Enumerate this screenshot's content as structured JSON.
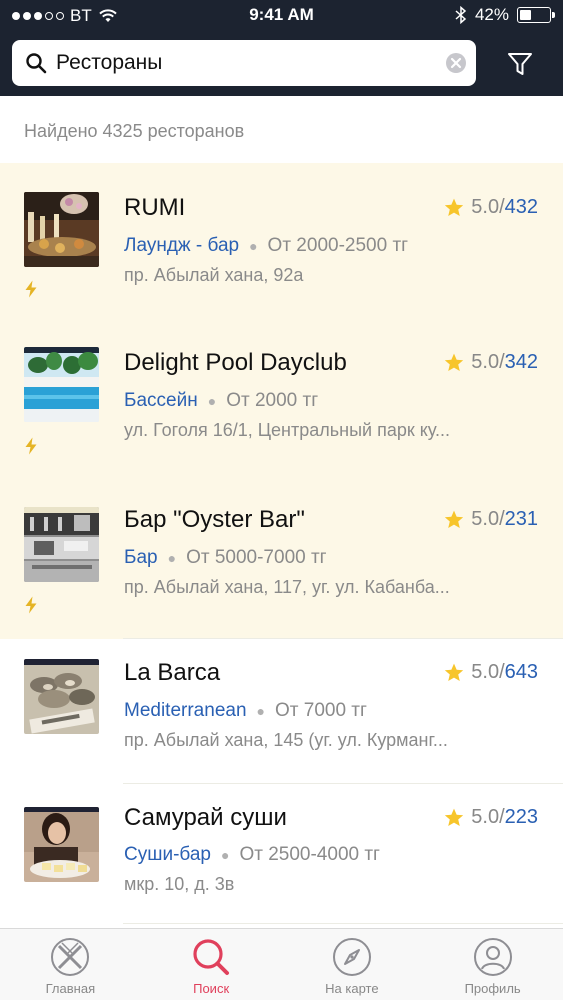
{
  "status_bar": {
    "carrier": "BT",
    "time": "9:41 AM",
    "battery_percent": "42%",
    "battery_level": 0.42,
    "signal_bars_filled": 3,
    "signal_bars_total": 5
  },
  "search": {
    "value": "Рестораны"
  },
  "results": {
    "found_text": "Найдено 4325 ресторанов"
  },
  "restaurants": [
    {
      "name": "RUMI",
      "score": "5.0/",
      "reviews": "432",
      "category": "Лаундж - бар",
      "price": "От 2000-2500 тг",
      "address": "пр. Абылай хана, 92а",
      "featured": true,
      "thumb": "rumi"
    },
    {
      "name": "Delight Pool Dayclub",
      "score": "5.0/",
      "reviews": "342",
      "category": "Бассейн",
      "price": "От 2000 тг",
      "address": "ул. Гоголя 16/1, Центральный парк ку...",
      "featured": true,
      "thumb": "pool"
    },
    {
      "name": "Бар \"Oyster Bar\"",
      "score": "5.0/",
      "reviews": "231",
      "category": "Бар",
      "price": "От 5000-7000 тг",
      "address": "пр. Абылай хана, 117, уг. ул. Кабанба...",
      "featured": true,
      "thumb": "oyster"
    },
    {
      "name": "La Barca",
      "score": "5.0/",
      "reviews": "643",
      "category": "Mediterranean",
      "price": "От 7000 тг",
      "address": "пр. Абылай хана, 145 (уг. ул. Курманг...",
      "featured": false,
      "thumb": "barca"
    },
    {
      "name": "Самурай суши",
      "score": "5.0/",
      "reviews": "223",
      "category": "Суши-бар",
      "price": "От 2500-4000 тг",
      "address": "мкр. 10, д. 3в",
      "featured": false,
      "thumb": "sushi"
    }
  ],
  "tabbar": {
    "tabs": [
      {
        "label": "Главная",
        "icon": "home-plate-icon",
        "active": false
      },
      {
        "label": "Поиск",
        "icon": "search-icon",
        "active": true
      },
      {
        "label": "На карте",
        "icon": "compass-icon",
        "active": false
      },
      {
        "label": "Профиль",
        "icon": "profile-icon",
        "active": false
      }
    ]
  },
  "colors": {
    "header_bg": "#1c2330",
    "accent_blue": "#2a60b3",
    "accent_red": "#e0405c",
    "star_yellow": "#f7c52b",
    "featured_bg": "#fdf8e7"
  }
}
